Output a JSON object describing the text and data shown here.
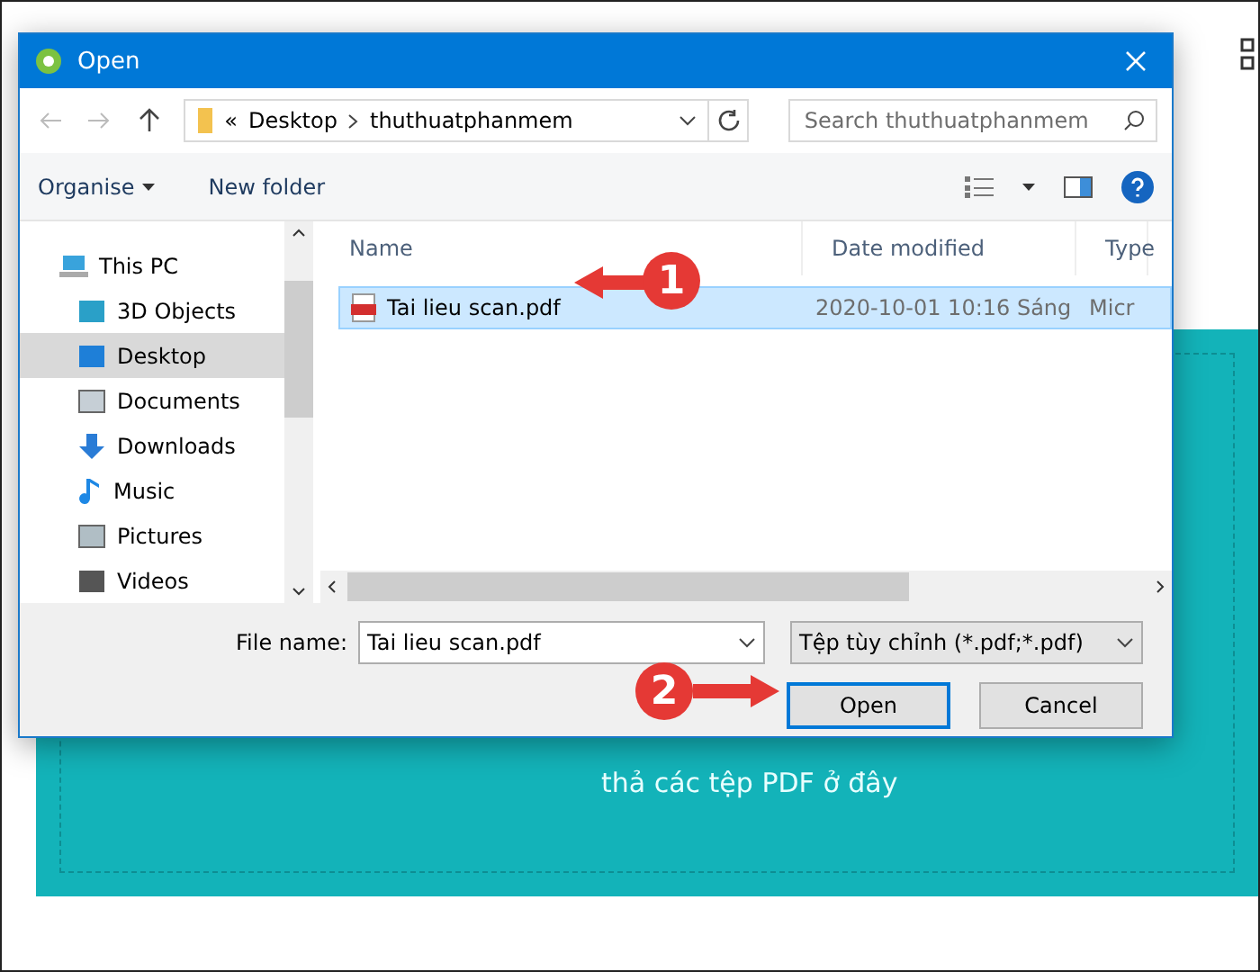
{
  "drop_zone": {
    "text": "thả các tệp PDF ở đây"
  },
  "dialog": {
    "title": "Open",
    "address": {
      "overflow": "«",
      "path": [
        "Desktop",
        "thuthuatphanmem"
      ]
    },
    "search": {
      "placeholder": "Search thuthuatphanmem"
    },
    "toolbar": {
      "organise": "Organise",
      "new_folder": "New folder"
    },
    "nav": [
      {
        "label": "This PC",
        "selected": false,
        "children": [
          {
            "label": "3D Objects",
            "selected": false
          },
          {
            "label": "Desktop",
            "selected": true
          },
          {
            "label": "Documents",
            "selected": false
          },
          {
            "label": "Downloads",
            "selected": false
          },
          {
            "label": "Music",
            "selected": false
          },
          {
            "label": "Pictures",
            "selected": false
          },
          {
            "label": "Videos",
            "selected": false
          }
        ]
      }
    ],
    "columns": [
      "Name",
      "Date modified",
      "Type"
    ],
    "files": [
      {
        "name": "Tai lieu scan.pdf",
        "date": "2020-10-01 10:16 Sáng",
        "type": "Micr",
        "selected": true
      }
    ],
    "file_name": {
      "label": "File name:",
      "value": "Tai lieu scan.pdf"
    },
    "filter": "Tệp tùy chỉnh (*.pdf;*.pdf)",
    "buttons": [
      {
        "label": "Open",
        "default": true
      },
      {
        "label": "Cancel",
        "default": false
      }
    ]
  },
  "annotations": [
    {
      "number": "1"
    },
    {
      "number": "2"
    }
  ]
}
